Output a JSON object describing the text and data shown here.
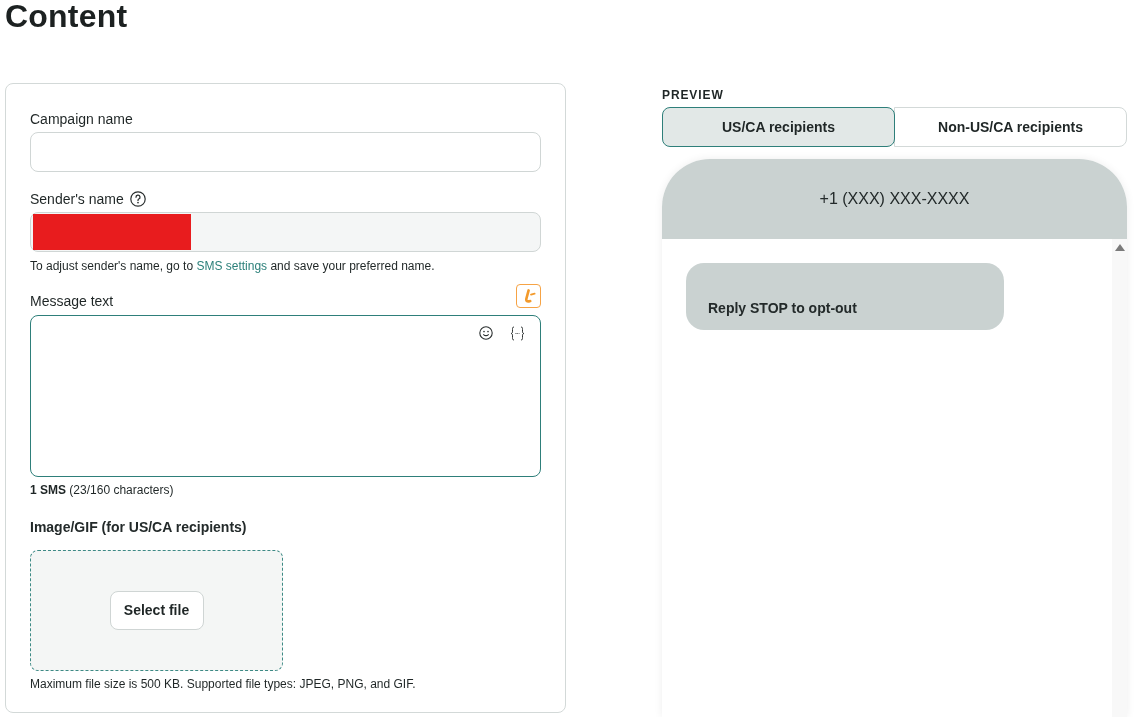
{
  "page": {
    "title": "Content"
  },
  "form": {
    "campaign_name": {
      "label": "Campaign name"
    },
    "sender_name": {
      "label": "Sender's name",
      "has_help": true,
      "disabled": true,
      "redacted": true,
      "hint": {
        "before": "To adjust sender's name, go to",
        "link": "SMS settings",
        "after": "and save your preferred name."
      }
    },
    "message_text": {
      "label": "Message text",
      "focused": true,
      "counter": "**1 SMS** (23/160 characters)"
    },
    "image": {
      "label": "Image/GIF (for US/CA recipients)",
      "button": "Select file",
      "note": "Maximum file size is 500 KB. Supported file types: JPEG, PNG, and GIF."
    }
  },
  "preview": {
    "heading": "PREVIEW",
    "tabs": [
      {
        "label": "US/CA recipients",
        "selected": true
      },
      {
        "label": "Non-US/CA recipients",
        "selected": false
      }
    ],
    "phone": {
      "number": "+1 (XXX) XXX-XXXX",
      "messages": [
        {
          "text": "Reply STOP to opt-out"
        }
      ]
    }
  }
}
